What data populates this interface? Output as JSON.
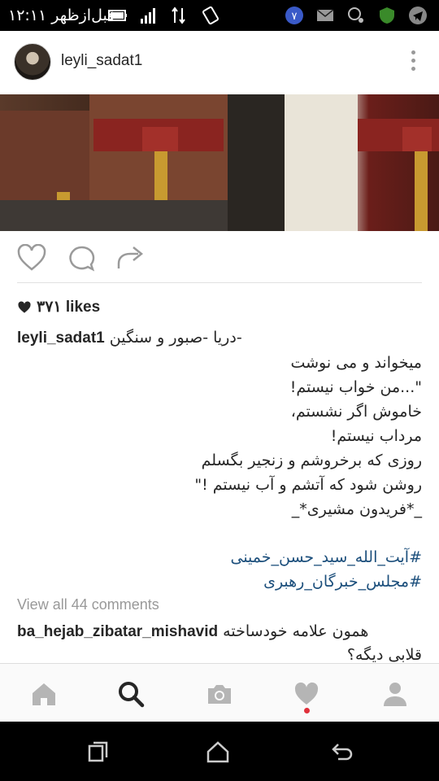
{
  "status_bar": {
    "time": "۱۲:۱۱ قبل‌ازظهر",
    "icons": [
      "screen-rotate-icon",
      "data-arrows-icon",
      "signal-icon",
      "battery-icon",
      "telegram-icon",
      "shield-icon",
      "pin-icon",
      "mail-icon",
      "v-badge-icon"
    ]
  },
  "post": {
    "username": "leyli_sadat1",
    "likes": "۳۷۱ likes",
    "caption_user": "leyli_sadat1",
    "caption_lines": [
      "-دریا -صبور و سنگین",
      "میخواند و می نوشت",
      "\"...من خواب نیستم!",
      "خاموش اگر نشستم،",
      "مرداب نیستم!",
      "روزی که برخروشم و زنجیر بگسلم",
      "روشن شود که آتشم و آب نیستم !\"",
      "_*فریدون مشیری*_"
    ],
    "hashtags": [
      "#آیت_الله_سید_حسن_خمینی",
      "#مجلس_خبرگان_رهبری"
    ],
    "view_all": "View all 44 comments",
    "comment_user": "ba_hejab_zibatar_mishavid",
    "comment_text_1": "همون علامه خودساخته",
    "comment_text_2": "قلابی دیگه؟"
  },
  "colors": {
    "accent_dot": "#e0303b",
    "hashtag": "#1c4f7c"
  }
}
